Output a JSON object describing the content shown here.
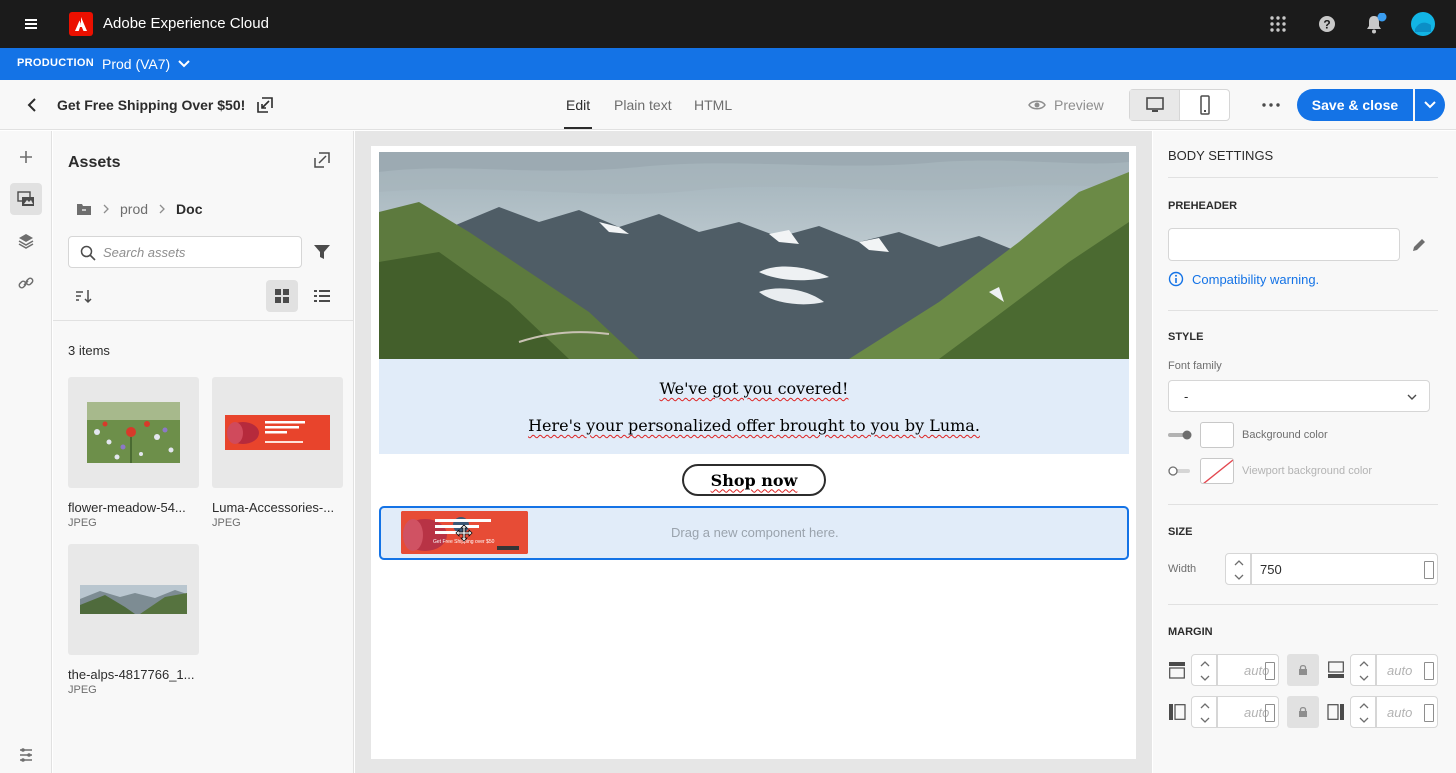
{
  "topbar": {
    "app_title": "Adobe Experience Cloud"
  },
  "environment": {
    "label": "PRODUCTION",
    "value": "Prod (VA7)"
  },
  "header": {
    "message_title": "Get Free Shipping Over $50!",
    "tabs": [
      {
        "label": "Edit"
      },
      {
        "label": "Plain text"
      },
      {
        "label": "HTML"
      }
    ],
    "preview_label": "Preview",
    "save_label": "Save & close"
  },
  "assets": {
    "title": "Assets",
    "breadcrumb": {
      "parent": "prod",
      "current": "Doc"
    },
    "search_placeholder": "Search assets",
    "count": "3 items",
    "items": [
      {
        "name": "flower-meadow-54...",
        "type": "JPEG"
      },
      {
        "name": "Luma-Accessories-...",
        "type": "JPEG"
      },
      {
        "name": "the-alps-4817766_1...",
        "type": "JPEG"
      }
    ]
  },
  "email": {
    "line1": "We've got you covered!",
    "line2": "Here's your personalized offer brought to you by Luma.",
    "button": "Shop now",
    "dropzone": "Drag a new component here.",
    "banner_text": "Get Free Shipping over $50"
  },
  "settings": {
    "title": "BODY SETTINGS",
    "preheader_label": "PREHEADER",
    "compat": "Compatibility warning.",
    "style_label": "STYLE",
    "font_family_label": "Font family",
    "font_family_value": "-",
    "bg_color_label": "Background color",
    "viewport_bg_label": "Viewport background color",
    "size_label": "SIZE",
    "width_label": "Width",
    "width_value": "750",
    "margin_label": "MARGIN",
    "auto": "auto"
  },
  "colors": {
    "accent": "#1473e6",
    "topbar": "#1b1b1b",
    "brand_red": "#eb1000"
  }
}
